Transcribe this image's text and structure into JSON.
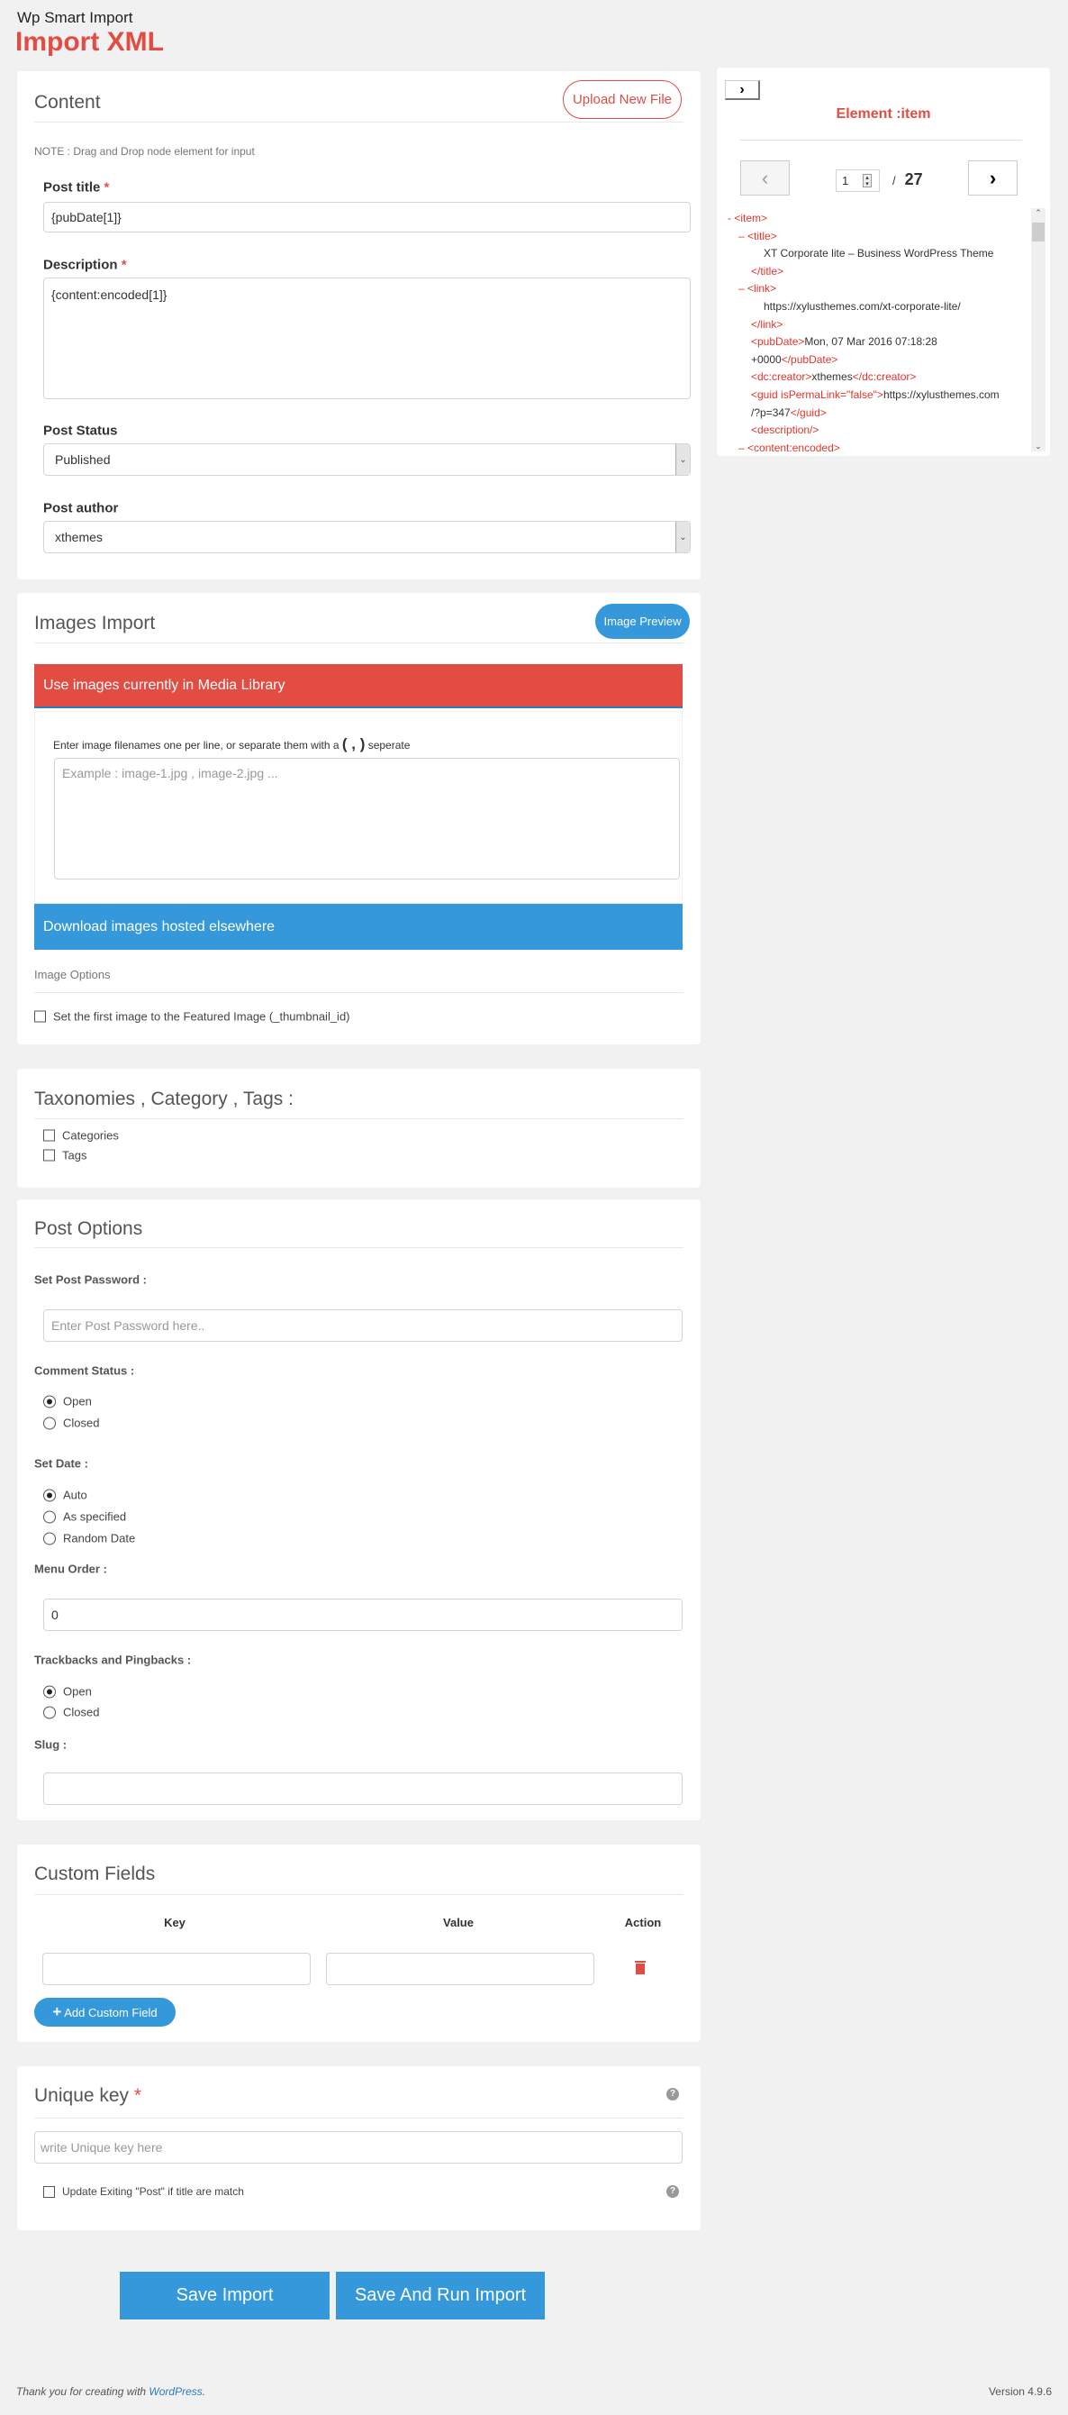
{
  "header": {
    "app_name": "Wp Smart Import",
    "page_title": "Import XML"
  },
  "colors": {
    "accent_red": "#e24c43",
    "accent_blue": "#3498db"
  },
  "content": {
    "title": "Content",
    "upload_label": "Upload New File",
    "note": "NOTE : Drag and Drop node element for input",
    "post_title_label": "Post title",
    "post_title_value": "{pubDate[1]}",
    "description_label": "Description",
    "description_value": "{content:encoded[1]}",
    "post_status_label": "Post Status",
    "post_status_value": "Published",
    "post_author_label": "Post author",
    "post_author_value": "xthemes",
    "required_mark": "*"
  },
  "xml_panel": {
    "toggle_icon": "chevron-right-icon",
    "title": "Element :item",
    "page_value": "1",
    "page_separator": "/",
    "page_total": "27",
    "lines": [
      {
        "pre": "- ",
        "open": "<item>",
        "indent": 0
      },
      {
        "pre": "– ",
        "open": "<title>",
        "indent": 1
      },
      {
        "text": "XT Corporate lite – Business WordPress Theme",
        "indent": 2
      },
      {
        "open": "</title>",
        "indent": 1
      },
      {
        "pre": "– ",
        "open": "<link>",
        "indent": 1
      },
      {
        "text": "https://xylusthemes.com/xt-corporate-lite/",
        "indent": 2
      },
      {
        "open": "</link>",
        "indent": 1
      },
      {
        "open": "<pubDate>",
        "text": "Mon, 07 Mar 2016 07:18:28",
        "indent": 1
      },
      {
        "text": "+0000",
        "close": "</pubDate>",
        "indent": 1
      },
      {
        "open": "<dc:creator>",
        "text": "xthemes",
        "close": "</dc:creator>",
        "indent": 1
      },
      {
        "open": "<guid isPermaLink=\"false\">",
        "text": "https://xylusthemes.com",
        "indent": 1
      },
      {
        "text": "/?p=347",
        "close": "</guid>",
        "indent": 1
      },
      {
        "open": "<description/>",
        "indent": 1
      },
      {
        "pre": "– ",
        "open": "<content:encoded>",
        "indent": 1
      }
    ]
  },
  "images": {
    "title": "Images Import",
    "preview_label": "Image Preview",
    "media_library_label": "Use images currently in Media Library",
    "instructions_before": "Enter image filenames one per line, or separate them with a",
    "instructions_mark": "( , )",
    "instructions_after": "seperate",
    "filenames_placeholder": "Example : image-1.jpg , image-2.jpg ...",
    "download_label": "Download images hosted elsewhere",
    "options_label": "Image Options",
    "featured_label": "Set the first image to the Featured Image (_thumbnail_id)"
  },
  "taxonomies": {
    "title": "Taxonomies , Category , Tags :",
    "items": [
      "Categories",
      "Tags"
    ]
  },
  "post_options": {
    "title": "Post Options",
    "password_label": "Set Post Password :",
    "password_placeholder": "Enter Post Password here..",
    "comment_label": "Comment Status :",
    "comment_options": [
      "Open",
      "Closed"
    ],
    "comment_selected": "Open",
    "date_label": "Set Date :",
    "date_options": [
      "Auto",
      "As specified",
      "Random Date"
    ],
    "date_selected": "Auto",
    "menu_order_label": "Menu Order :",
    "menu_order_value": "0",
    "trackbacks_label": "Trackbacks and Pingbacks :",
    "trackbacks_options": [
      "Open",
      "Closed"
    ],
    "trackbacks_selected": "Open",
    "slug_label": "Slug :"
  },
  "custom_fields": {
    "title": "Custom Fields",
    "columns": [
      "Key",
      "Value",
      "Action"
    ],
    "add_label": "Add Custom Field"
  },
  "unique_key": {
    "title": "Unique key",
    "placeholder": "write Unique key here",
    "update_label": "Update Exiting \"Post\" if title are match"
  },
  "actions": {
    "save": "Save Import",
    "save_run": "Save And Run Import"
  },
  "footer": {
    "thanks_before": "Thank you for creating with",
    "thanks_link": "WordPress",
    "thanks_after": ".",
    "version": "Version 4.9.6"
  }
}
